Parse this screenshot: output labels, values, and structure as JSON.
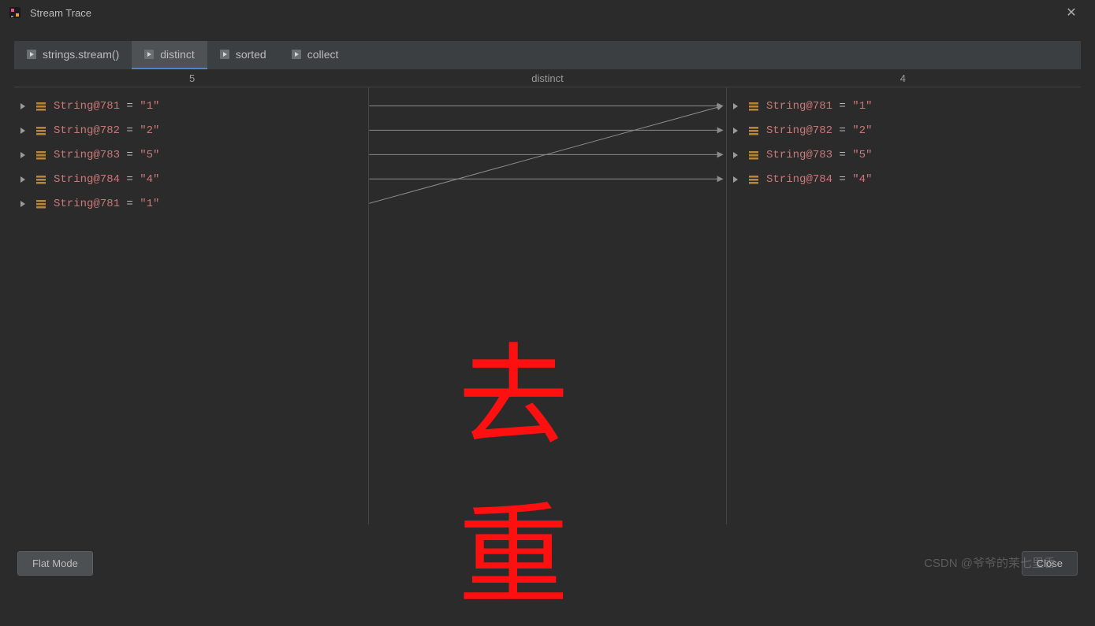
{
  "window": {
    "title": "Stream Trace"
  },
  "tabs": [
    {
      "label": "strings.stream()"
    },
    {
      "label": "distinct"
    },
    {
      "label": "sorted"
    },
    {
      "label": "collect"
    }
  ],
  "active_tab_index": 1,
  "header": {
    "left_count": "5",
    "operation": "distinct",
    "right_count": "4"
  },
  "left_items": [
    {
      "name": "String@781",
      "eq": " = ",
      "value": "\"1\""
    },
    {
      "name": "String@782",
      "eq": " = ",
      "value": "\"2\""
    },
    {
      "name": "String@783",
      "eq": " = ",
      "value": "\"5\""
    },
    {
      "name": "String@784",
      "eq": " = ",
      "value": "\"4\""
    },
    {
      "name": "String@781",
      "eq": " = ",
      "value": "\"1\""
    }
  ],
  "right_items": [
    {
      "name": "String@781",
      "eq": " = ",
      "value": "\"1\""
    },
    {
      "name": "String@782",
      "eq": " = ",
      "value": "\"2\""
    },
    {
      "name": "String@783",
      "eq": " = ",
      "value": "\"5\""
    },
    {
      "name": "String@784",
      "eq": " = ",
      "value": "\"4\""
    }
  ],
  "connectors": [
    {
      "from": 0,
      "to": 0
    },
    {
      "from": 1,
      "to": 1
    },
    {
      "from": 2,
      "to": 2
    },
    {
      "from": 3,
      "to": 3
    },
    {
      "from": 4,
      "to": 0
    }
  ],
  "annotation": "去重",
  "footer": {
    "flat_mode": "Flat Mode",
    "close": "Close"
  },
  "watermark": "CSDN @爷爷的茉七里香"
}
